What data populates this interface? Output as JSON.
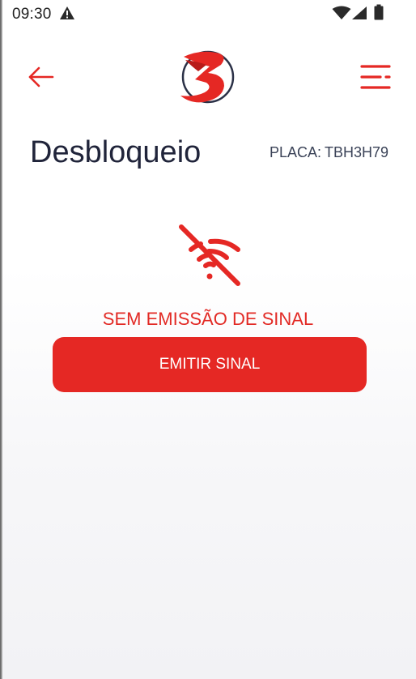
{
  "status_bar": {
    "time": "09:30",
    "icons": [
      "warning-icon",
      "wifi-icon",
      "cell-signal-icon",
      "battery-icon"
    ]
  },
  "header": {
    "back_icon": "arrow-left-icon",
    "logo": "brand-logo",
    "menu_icon": "menu-icon"
  },
  "page": {
    "title": "Desbloqueio",
    "plate_label": "PLACA:",
    "plate_value": "TBH3H79"
  },
  "signal": {
    "icon": "wifi-off-icon",
    "message": "SEM EMISSÃO DE SINAL",
    "button_label": "EMITIR SINAL"
  },
  "colors": {
    "accent": "#e52824",
    "title": "#20243a",
    "text_secondary": "#3a4257"
  }
}
